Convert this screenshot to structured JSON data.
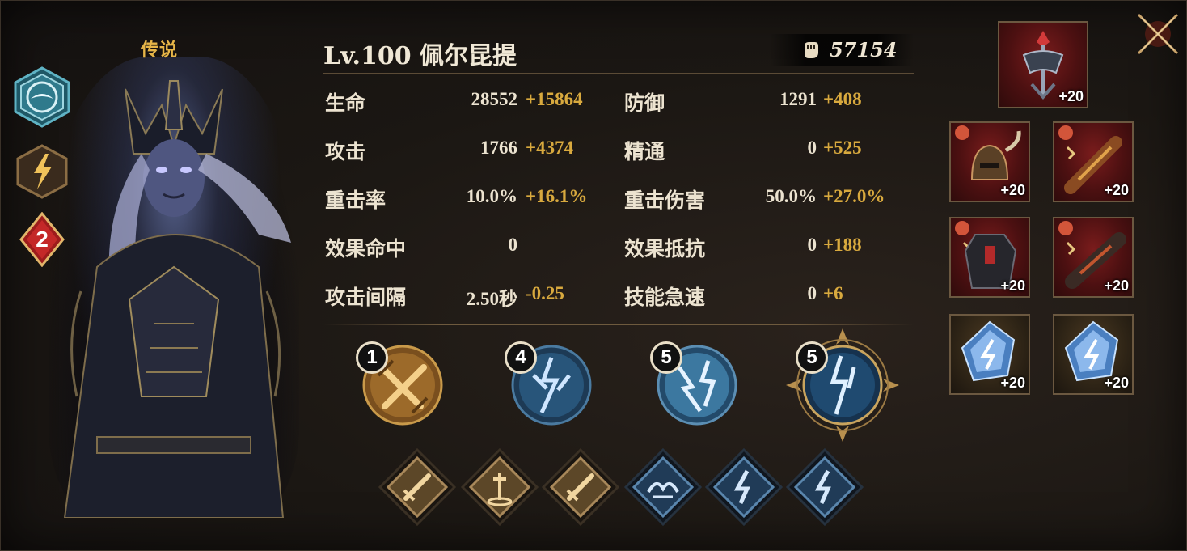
{
  "hero": {
    "rarity": "传说",
    "title": "Lv.100 佩尔昆提",
    "power": "57154",
    "element_icon": "water-element-icon",
    "class_icon": "lightning-class-icon",
    "rank": "2"
  },
  "stats": [
    {
      "label": "生命",
      "base": "28552",
      "bonus": "+15864",
      "label2": "防御",
      "base2": "1291",
      "bonus2": "+408"
    },
    {
      "label": "攻击",
      "base": "1766",
      "bonus": "+4374",
      "label2": "精通",
      "base2": "0",
      "bonus2": "+525"
    },
    {
      "label": "重击率",
      "base": "10.0%",
      "bonus": "+16.1%",
      "label2": "重击伤害",
      "base2": "50.0%",
      "bonus2": "+27.0%"
    },
    {
      "label": "效果命中",
      "base": "0",
      "bonus": "",
      "label2": "效果抵抗",
      "base2": "0",
      "bonus2": "+188"
    },
    {
      "label": "攻击间隔",
      "base": "2.50秒",
      "bonus": "-0.25",
      "label2": "技能急速",
      "base2": "0",
      "bonus2": "+6"
    }
  ],
  "skills": [
    {
      "level": "1",
      "icon": "crossed-swords-skill-icon"
    },
    {
      "level": "4",
      "icon": "lightning-burst-skill-icon"
    },
    {
      "level": "5",
      "icon": "lightning-strike-skill-icon"
    },
    {
      "level": "5",
      "icon": "lightning-ultimate-skill-icon"
    }
  ],
  "runes": [
    "sword-rune-icon",
    "dagger-rune-icon",
    "sword-rune-icon",
    "wing-rune-icon",
    "lightning-rune-icon",
    "lightning-rune-icon"
  ],
  "equipment": {
    "main": {
      "icon": "scepter-icon",
      "level": "+20"
    },
    "slots": [
      {
        "icon": "helmet-icon",
        "level": "+20"
      },
      {
        "icon": "gauntlet-icon",
        "level": "+20"
      },
      {
        "icon": "chest-armor-icon",
        "level": "+20"
      },
      {
        "icon": "gauntlet-icon",
        "level": "+20"
      },
      {
        "icon": "lightning-gem-icon",
        "level": "+20"
      },
      {
        "icon": "lightning-gem-icon",
        "level": "+20"
      }
    ]
  },
  "colors": {
    "gold": "#d8a93e",
    "water": "#2f7a8c",
    "rune_gold": "#8a6a3a",
    "rune_blue": "#2a4b6b"
  }
}
